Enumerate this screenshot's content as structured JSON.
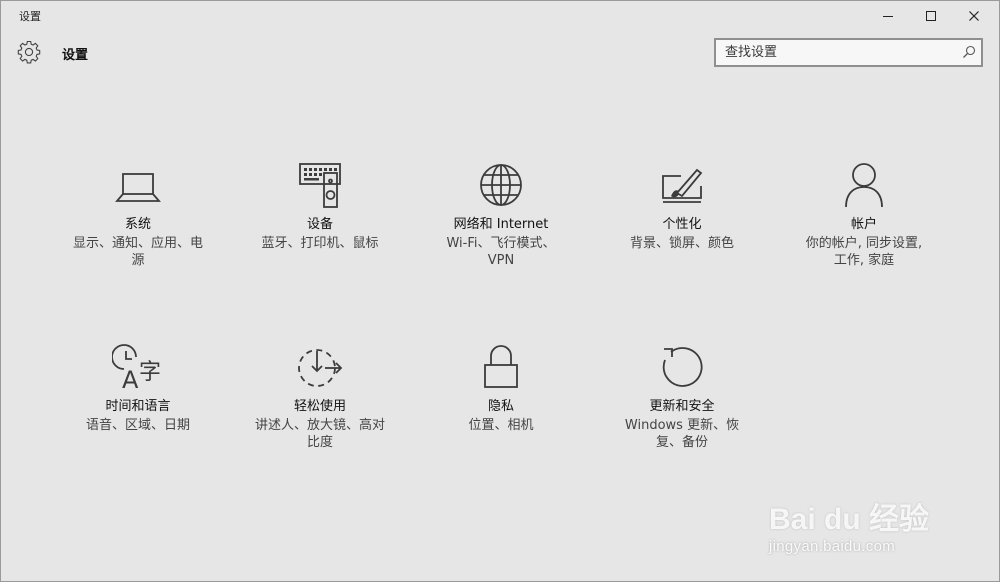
{
  "window": {
    "title": "设置",
    "controls": {
      "minimize_icon": "minimize-icon",
      "maximize_icon": "maximize-icon",
      "close_icon": "close-icon"
    }
  },
  "header": {
    "title": "设置",
    "icon": "gear-icon",
    "search": {
      "placeholder": "查找设置",
      "value": "",
      "icon": "search-icon"
    }
  },
  "categories": [
    {
      "icon": "laptop-icon",
      "title": "系统",
      "desc": "显示、通知、应用、电源"
    },
    {
      "icon": "keyboard-speaker-icon",
      "title": "设备",
      "desc": "蓝牙、打印机、鼠标"
    },
    {
      "icon": "globe-icon",
      "title": "网络和 Internet",
      "desc": "Wi-Fi、飞行模式、VPN"
    },
    {
      "icon": "paint-screen-icon",
      "title": "个性化",
      "desc": "背景、锁屏、颜色"
    },
    {
      "icon": "person-icon",
      "title": "帐户",
      "desc": "你的帐户, 同步设置, 工作, 家庭"
    },
    {
      "icon": "time-language-icon",
      "title": "时间和语言",
      "desc": "语音、区域、日期"
    },
    {
      "icon": "ease-of-access-icon",
      "title": "轻松使用",
      "desc": "讲述人、放大镜、高对比度"
    },
    {
      "icon": "lock-icon",
      "title": "隐私",
      "desc": "位置、相机"
    },
    {
      "icon": "refresh-icon",
      "title": "更新和安全",
      "desc": "Windows 更新、恢复、备份"
    }
  ],
  "watermark": {
    "logo": "Bai du 经验",
    "url": "jingyan.baidu.com"
  },
  "colors": {
    "background": "#e6e6e6",
    "icon_stroke": "#3c3c3c",
    "text": "#111111",
    "subtext": "#444444"
  }
}
